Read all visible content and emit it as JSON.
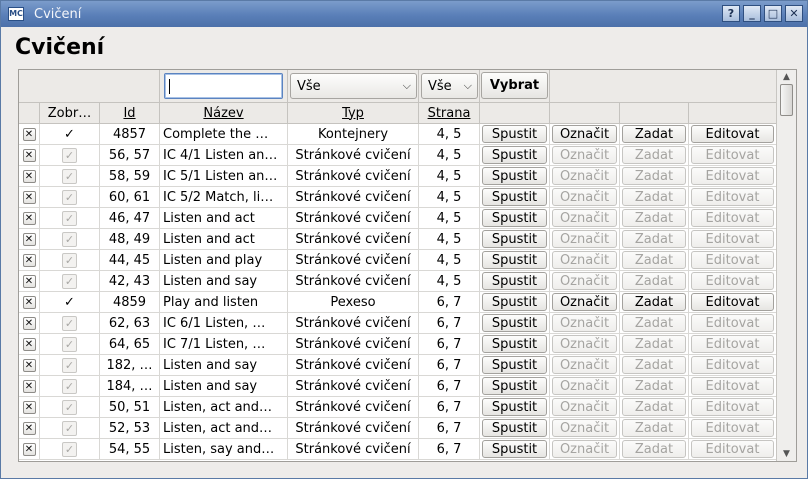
{
  "window": {
    "app_icon_text": "MC",
    "title": "Cvičení",
    "controls": {
      "help": "?",
      "minimize": "_",
      "maximize": "□",
      "close": "✕"
    }
  },
  "page": {
    "heading": "Cvičení"
  },
  "filter": {
    "search_value": "",
    "type_selected": "Vše",
    "page_selected": "Vše",
    "select_button": "Vybrat"
  },
  "columns": {
    "show": "Zobr…",
    "id": "Id",
    "name": "Název",
    "type": "Typ",
    "page": "Strana"
  },
  "row_buttons": {
    "run": "Spustit",
    "mark": "Označit",
    "assign": "Zadat",
    "edit": "Editovat"
  },
  "rows": [
    {
      "shown": true,
      "id": "4857",
      "name": "Complete the …",
      "type": "Kontejnery",
      "page": "4, 5",
      "enabled": true
    },
    {
      "shown": false,
      "id": "56, 57",
      "name": "IC 4/1 Listen an…",
      "type": "Stránkové cvičení",
      "page": "4, 5",
      "enabled": false
    },
    {
      "shown": false,
      "id": "58, 59",
      "name": "IC 5/1 Listen an…",
      "type": "Stránkové cvičení",
      "page": "4, 5",
      "enabled": false
    },
    {
      "shown": false,
      "id": "60, 61",
      "name": "IC 5/2 Match, li…",
      "type": "Stránkové cvičení",
      "page": "4, 5",
      "enabled": false
    },
    {
      "shown": false,
      "id": "46, 47",
      "name": "Listen and act",
      "type": "Stránkové cvičení",
      "page": "4, 5",
      "enabled": false
    },
    {
      "shown": false,
      "id": "48, 49",
      "name": "Listen and act",
      "type": "Stránkové cvičení",
      "page": "4, 5",
      "enabled": false
    },
    {
      "shown": false,
      "id": "44, 45",
      "name": "Listen and play",
      "type": "Stránkové cvičení",
      "page": "4, 5",
      "enabled": false
    },
    {
      "shown": false,
      "id": "42, 43",
      "name": "Listen and say",
      "type": "Stránkové cvičení",
      "page": "4, 5",
      "enabled": false
    },
    {
      "shown": true,
      "id": "4859",
      "name": "Play and listen",
      "type": "Pexeso",
      "page": "6, 7",
      "enabled": true
    },
    {
      "shown": false,
      "id": "62, 63",
      "name": "IC 6/1 Listen, …",
      "type": "Stránkové cvičení",
      "page": "6, 7",
      "enabled": false
    },
    {
      "shown": false,
      "id": "64, 65",
      "name": "IC 7/1 Listen, …",
      "type": "Stránkové cvičení",
      "page": "6, 7",
      "enabled": false
    },
    {
      "shown": false,
      "id": "182, …",
      "name": "Listen and say",
      "type": "Stránkové cvičení",
      "page": "6, 7",
      "enabled": false
    },
    {
      "shown": false,
      "id": "184, …",
      "name": "Listen and say",
      "type": "Stránkové cvičení",
      "page": "6, 7",
      "enabled": false
    },
    {
      "shown": false,
      "id": "50, 51",
      "name": "Listen, act and…",
      "type": "Stránkové cvičení",
      "page": "6, 7",
      "enabled": false
    },
    {
      "shown": false,
      "id": "52, 53",
      "name": "Listen, act and…",
      "type": "Stránkové cvičení",
      "page": "6, 7",
      "enabled": false
    },
    {
      "shown": false,
      "id": "54, 55",
      "name": "Listen, say and…",
      "type": "Stránkové cvičení",
      "page": "6, 7",
      "enabled": false
    }
  ]
}
